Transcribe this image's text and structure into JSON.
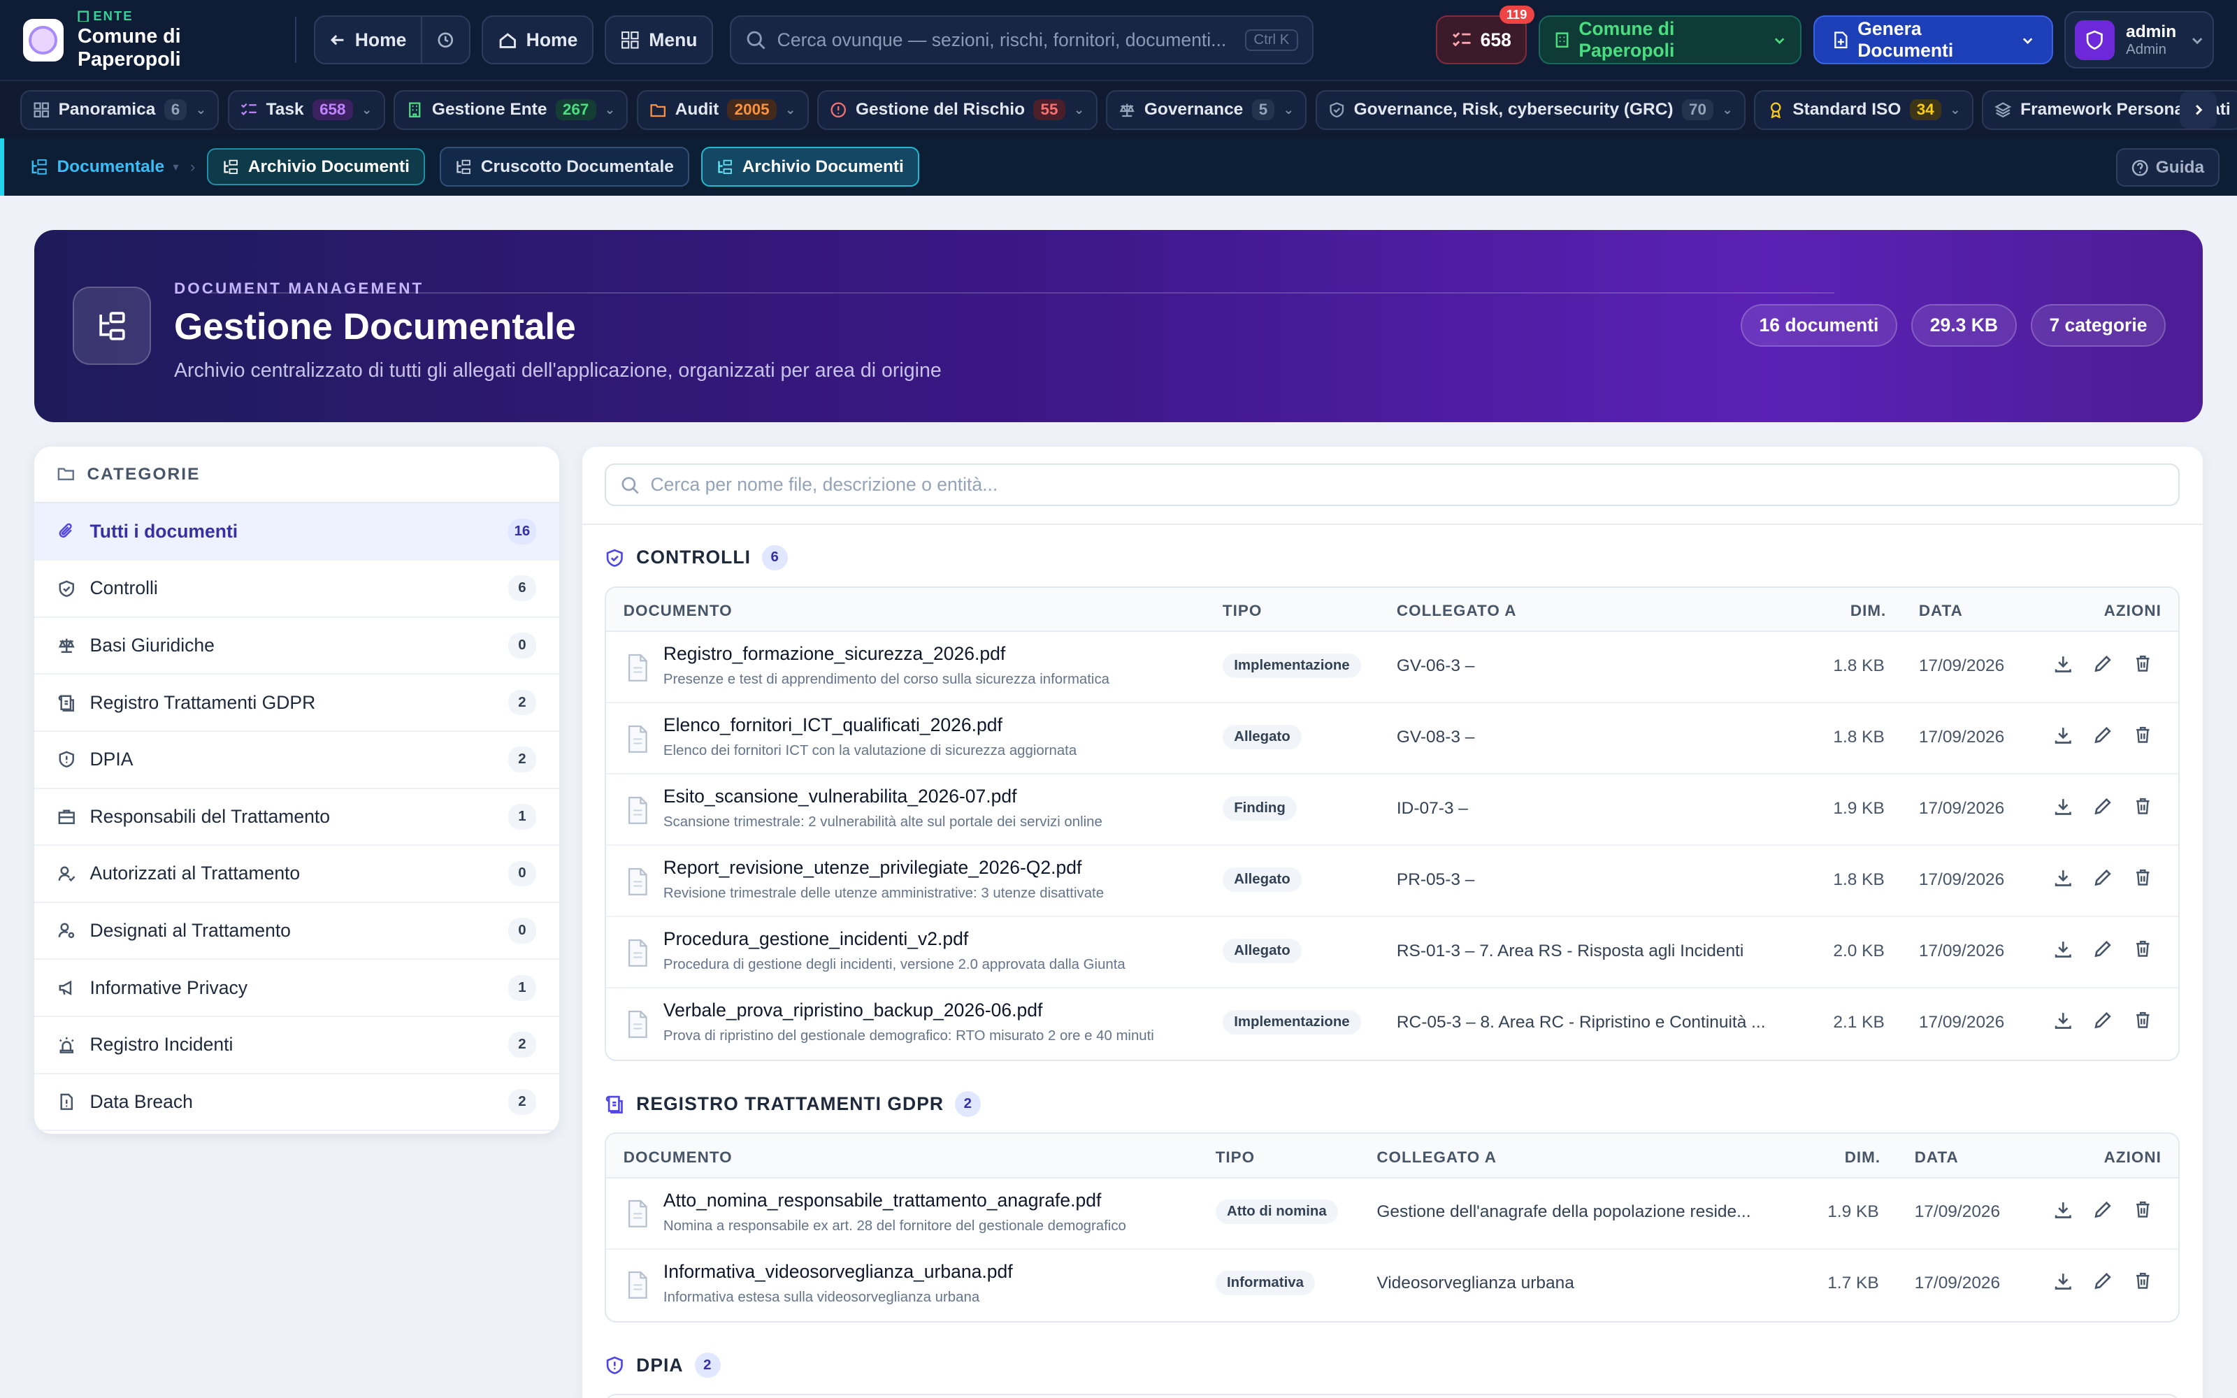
{
  "topbar": {
    "ente_kicker": "ENTE",
    "ente_name": "Comune di Paperopoli",
    "back_label": "Home",
    "home_label": "Home",
    "menu_label": "Menu",
    "search_placeholder": "Cerca ovunque — sezioni, rischi, fornitori, documenti...",
    "search_shortcut": "Ctrl K",
    "task_count": "658",
    "notif_count": "119",
    "org_label": "Comune di Paperopoli",
    "generate_label": "Genera Documenti",
    "user_name": "admin",
    "user_role": "Admin"
  },
  "modules": [
    {
      "label": "Panoramica",
      "count": "6",
      "icon": "grid-icon",
      "color": "#94a3b8",
      "bg": "#26334f"
    },
    {
      "label": "Task",
      "count": "658",
      "icon": "checklist-icon",
      "color": "#c084fc",
      "bg": "#3b2160"
    },
    {
      "label": "Gestione Ente",
      "count": "267",
      "icon": "building-icon",
      "color": "#4ade80",
      "bg": "#143d33"
    },
    {
      "label": "Audit",
      "count": "2005",
      "icon": "folder-icon",
      "color": "#fb923c",
      "bg": "#432a1c"
    },
    {
      "label": "Gestione del Rischio",
      "count": "55",
      "icon": "alert-icon",
      "color": "#f87171",
      "bg": "#4a1f2a"
    },
    {
      "label": "Governance",
      "count": "5",
      "icon": "scale-icon",
      "color": "#94a3b8",
      "bg": "#26334f"
    },
    {
      "label": "Governance, Risk, cybersecurity (GRC)",
      "count": "70",
      "icon": "shield-check-icon",
      "color": "#94a3b8",
      "bg": "#26334f"
    },
    {
      "label": "Standard ISO",
      "count": "34",
      "icon": "award-icon",
      "color": "#facc15",
      "bg": "#3d3518"
    },
    {
      "label": "Framework Personalizzati",
      "count": "",
      "icon": "layers-icon",
      "color": "#94a3b8",
      "bg": "#26334f"
    }
  ],
  "breadcrumb": {
    "root": "Documentale",
    "current": "Archivio Documenti",
    "tabs": [
      "Cruscotto Documentale",
      "Archivio Documenti"
    ],
    "guide": "Guida"
  },
  "hero": {
    "kicker": "DOCUMENT MANAGEMENT",
    "title": "Gestione Documentale",
    "subtitle": "Archivio centralizzato di tutti gli allegati dell'applicazione, organizzati per area di origine",
    "stats": [
      "16 documenti",
      "29.3 KB",
      "7 categorie"
    ]
  },
  "sidebar": {
    "title": "CATEGORIE",
    "items": [
      {
        "label": "Tutti i documenti",
        "count": "16",
        "icon": "paperclip-icon"
      },
      {
        "label": "Controlli",
        "count": "6",
        "icon": "shield-check-icon"
      },
      {
        "label": "Basi Giuridiche",
        "count": "0",
        "icon": "scale-icon"
      },
      {
        "label": "Registro Trattamenti GDPR",
        "count": "2",
        "icon": "book-icon"
      },
      {
        "label": "DPIA",
        "count": "2",
        "icon": "shield-alert-icon"
      },
      {
        "label": "Responsabili del Trattamento",
        "count": "1",
        "icon": "briefcase-icon"
      },
      {
        "label": "Autorizzati al Trattamento",
        "count": "0",
        "icon": "user-check-icon"
      },
      {
        "label": "Designati al Trattamento",
        "count": "0",
        "icon": "user-cog-icon"
      },
      {
        "label": "Informative Privacy",
        "count": "1",
        "icon": "megaphone-icon"
      },
      {
        "label": "Registro Incidenti",
        "count": "2",
        "icon": "siren-icon"
      },
      {
        "label": "Data Breach",
        "count": "2",
        "icon": "file-alert-icon"
      }
    ]
  },
  "main": {
    "search_placeholder": "Cerca per nome file, descrizione o entità...",
    "columns": {
      "doc": "DOCUMENTO",
      "tipo": "TIPO",
      "link": "COLLEGATO A",
      "dim": "DIM.",
      "data": "DATA",
      "azioni": "AZIONI"
    },
    "sections": [
      {
        "title": "CONTROLLI",
        "count": "6",
        "icon": "shield-check-icon",
        "rows": [
          {
            "name": "Registro_formazione_sicurezza_2026.pdf",
            "desc": "Presenze e test di apprendimento del corso sulla sicurezza informatica",
            "tipo": "Implementazione",
            "link": "GV-06-3 –",
            "dim": "1.8 KB",
            "data": "17/09/2026"
          },
          {
            "name": "Elenco_fornitori_ICT_qualificati_2026.pdf",
            "desc": "Elenco dei fornitori ICT con la valutazione di sicurezza aggiornata",
            "tipo": "Allegato",
            "link": "GV-08-3 –",
            "dim": "1.8 KB",
            "data": "17/09/2026"
          },
          {
            "name": "Esito_scansione_vulnerabilita_2026-07.pdf",
            "desc": "Scansione trimestrale: 2 vulnerabilità alte sul portale dei servizi online",
            "tipo": "Finding",
            "link": "ID-07-3 –",
            "dim": "1.9 KB",
            "data": "17/09/2026"
          },
          {
            "name": "Report_revisione_utenze_privilegiate_2026-Q2.pdf",
            "desc": "Revisione trimestrale delle utenze amministrative: 3 utenze disattivate",
            "tipo": "Allegato",
            "link": "PR-05-3 –",
            "dim": "1.8 KB",
            "data": "17/09/2026"
          },
          {
            "name": "Procedura_gestione_incidenti_v2.pdf",
            "desc": "Procedura di gestione degli incidenti, versione 2.0 approvata dalla Giunta",
            "tipo": "Allegato",
            "link": "RS-01-3 – 7. Area RS - Risposta agli Incidenti",
            "dim": "2.0 KB",
            "data": "17/09/2026"
          },
          {
            "name": "Verbale_prova_ripristino_backup_2026-06.pdf",
            "desc": "Prova di ripristino del gestionale demografico: RTO misurato 2 ore e 40 minuti",
            "tipo": "Implementazione",
            "link": "RC-05-3 – 8. Area RC - Ripristino e Continuità ...",
            "dim": "2.1 KB",
            "data": "17/09/2026"
          }
        ]
      },
      {
        "title": "REGISTRO TRATTAMENTI GDPR",
        "count": "2",
        "icon": "book-icon",
        "rows": [
          {
            "name": "Atto_nomina_responsabile_trattamento_anagrafe.pdf",
            "desc": "Nomina a responsabile ex art. 28 del fornitore del gestionale demografico",
            "tipo": "Atto di nomina",
            "link": "Gestione dell'anagrafe della popolazione reside...",
            "dim": "1.9 KB",
            "data": "17/09/2026"
          },
          {
            "name": "Informativa_videosorveglianza_urbana.pdf",
            "desc": "Informativa estesa sulla videosorveglianza urbana",
            "tipo": "Informativa",
            "link": "Videosorveglianza urbana",
            "dim": "1.7 KB",
            "data": "17/09/2026"
          }
        ]
      },
      {
        "title": "DPIA",
        "count": "2",
        "icon": "shield-alert-icon",
        "rows": []
      }
    ]
  },
  "colors": {
    "accent": "#4f46e5",
    "hero_start": "#1e1b5a",
    "hero_end": "#5b21b6"
  }
}
